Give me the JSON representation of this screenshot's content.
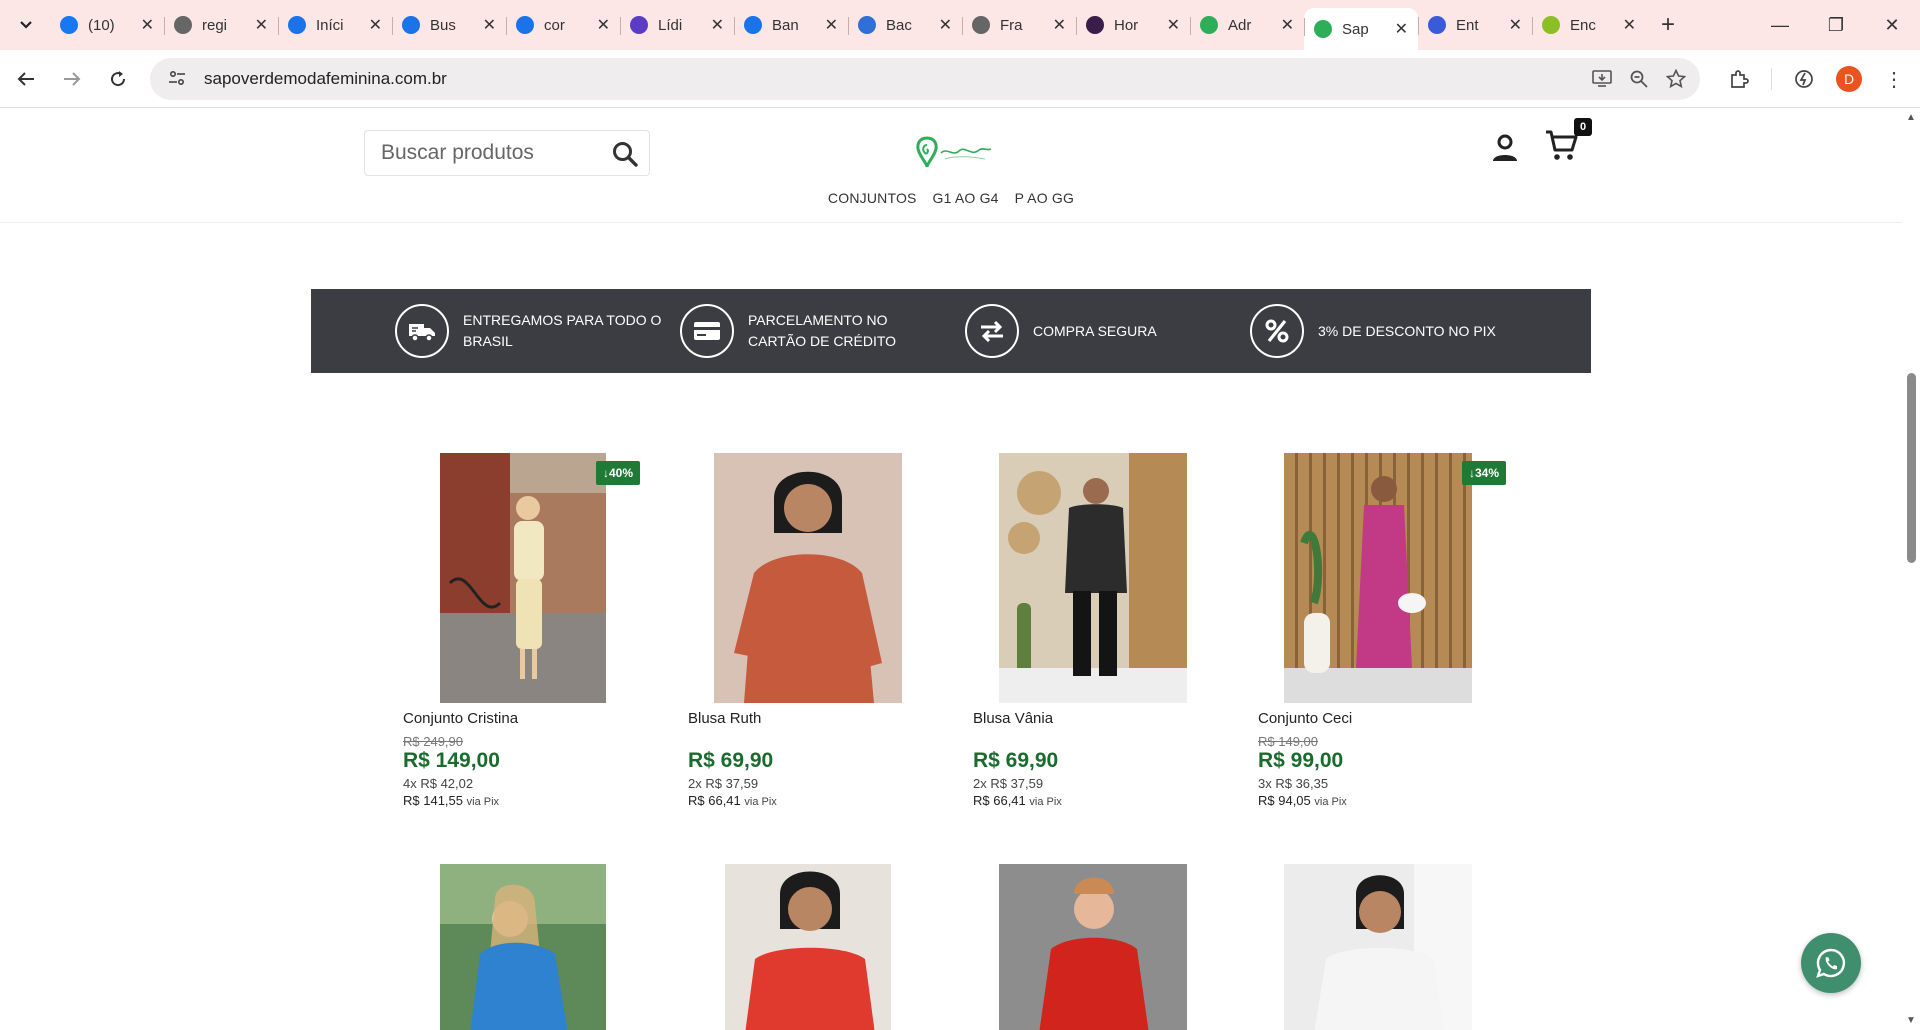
{
  "browser": {
    "tabs": [
      {
        "title": "(10)",
        "icon": "meta-icon",
        "color": "#1877f2"
      },
      {
        "title": "regi",
        "icon": "globe-icon",
        "color": "#666666"
      },
      {
        "title": "Iníci",
        "icon": "canva-icon",
        "color": "#1a73e8"
      },
      {
        "title": "Bus",
        "icon": "canva-icon",
        "color": "#1a73e8"
      },
      {
        "title": "cor",
        "icon": "canva-icon",
        "color": "#1a73e8"
      },
      {
        "title": "Lídi",
        "icon": "heart-chat-icon",
        "color": "#5b3cc4"
      },
      {
        "title": "Ban",
        "icon": "canva-icon",
        "color": "#1a73e8"
      },
      {
        "title": "Bac",
        "icon": "doc-icon",
        "color": "#2f6fd6"
      },
      {
        "title": "Fra",
        "icon": "globe-icon",
        "color": "#666666"
      },
      {
        "title": "Hor",
        "icon": "e-icon",
        "color": "#3a1d4a"
      },
      {
        "title": "Adr",
        "icon": "shield-icon",
        "color": "#2fae5a"
      },
      {
        "title": "Sap",
        "icon": "shield-icon",
        "color": "#2fae5a",
        "active": true
      },
      {
        "title": "Ent",
        "icon": "flow-icon",
        "color": "#3a5bd9"
      },
      {
        "title": "Enc",
        "icon": "bars-icon",
        "color": "#8cbf26"
      }
    ],
    "url": "sapoverdemodafeminina.com.br",
    "profile_initial": "D"
  },
  "header": {
    "search_placeholder": "Buscar produtos",
    "cart_count": "0",
    "menu": [
      "CONJUNTOS",
      "G1 AO G4",
      "P AO GG"
    ]
  },
  "benefits": [
    {
      "icon": "truck-icon",
      "text": "ENTREGAMOS PARA TODO O BRASIL"
    },
    {
      "icon": "card-icon",
      "text": "PARCELAMENTO NO CARTÃO DE CRÉDITO"
    },
    {
      "icon": "swap-icon",
      "text": "COMPRA SEGURA"
    },
    {
      "icon": "percent-icon",
      "text": "3% DE DESCONTO NO PIX"
    }
  ],
  "products": [
    {
      "name": "Conjunto Cristina",
      "old_price": "R$ 249,90",
      "price": "R$ 149,00",
      "installments": "4x R$ 42,02",
      "pix_price": "R$ 141,55",
      "pix_label": "via Pix",
      "badge": "40%",
      "bg": "#d9c6a3"
    },
    {
      "name": "Blusa Ruth",
      "old_price": "",
      "price": "R$ 69,90",
      "installments": "2x R$ 37,59",
      "pix_price": "R$ 66,41",
      "pix_label": "via Pix",
      "badge": "",
      "bg": "#c96a4e"
    },
    {
      "name": "Blusa Vânia",
      "old_price": "",
      "price": "R$ 69,90",
      "installments": "2x R$ 37,59",
      "pix_price": "R$ 66,41",
      "pix_label": "via Pix",
      "badge": "",
      "bg": "#c9b79b"
    },
    {
      "name": "Conjunto Ceci",
      "old_price": "R$ 149,00",
      "price": "R$ 99,00",
      "installments": "3x R$ 36,35",
      "pix_price": "R$ 94,05",
      "pix_label": "via Pix",
      "badge": "34%",
      "bg": "#b88f5f"
    }
  ],
  "products_row2": [
    {
      "bg": "#3d7fc4"
    },
    {
      "bg": "#d9473a"
    },
    {
      "bg": "#8f8f8f"
    },
    {
      "bg": "#e6e6e6"
    }
  ],
  "colors": {
    "brand_green": "#1a6b2e",
    "badge_green": "#1e7a34",
    "bar_dark": "#3c3d42",
    "whatsapp": "#3f8f6f",
    "tabstrip": "#fde6e6"
  }
}
